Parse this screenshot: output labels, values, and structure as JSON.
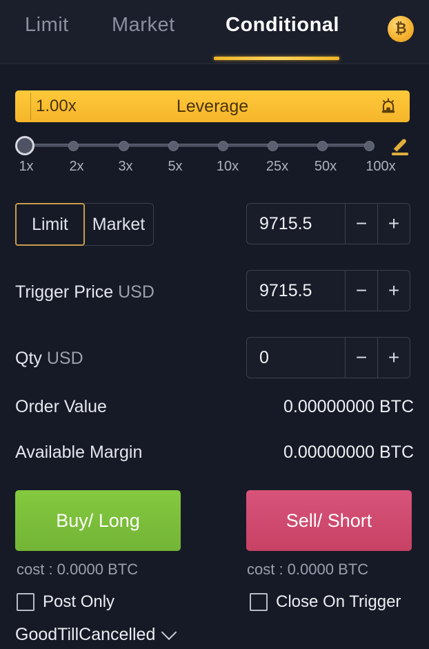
{
  "tabs": [
    {
      "label": "Limit",
      "selected": false
    },
    {
      "label": "Market",
      "selected": false
    },
    {
      "label": "Conditional",
      "selected": true
    }
  ],
  "header": {
    "currency_badge": "₿",
    "currency_icon": "bitcoin-icon"
  },
  "leverage": {
    "value": "1.00x",
    "label": "Leverage",
    "alarm_icon": "alarm-lamp-icon",
    "edit_icon": "pencil-edit-icon",
    "ticks": [
      "1x",
      "2x",
      "3x",
      "5x",
      "10x",
      "25x",
      "50x",
      "100x"
    ],
    "selected_tick_index": 0
  },
  "order_type": {
    "options": [
      {
        "label": "Limit",
        "selected": true
      },
      {
        "label": "Market",
        "selected": false
      }
    ]
  },
  "fields": [
    {
      "name": "price",
      "label": "",
      "unit": "",
      "value": "9715.5",
      "minus": "−",
      "plus": "+"
    },
    {
      "name": "trigger-price",
      "label": "Trigger Price",
      "unit": "USD",
      "value": "9715.5",
      "minus": "−",
      "plus": "+"
    },
    {
      "name": "qty",
      "label": "Qty",
      "unit": "USD",
      "value": "0",
      "minus": "−",
      "plus": "+"
    }
  ],
  "info": [
    {
      "label": "Order Value",
      "value": "0.00000000 BTC"
    },
    {
      "label": "Available Margin",
      "value": "0.00000000 BTC"
    }
  ],
  "actions": {
    "buy_label": "Buy/ Long",
    "sell_label": "Sell/ Short",
    "buy_cost": "cost : 0.0000 BTC",
    "sell_cost": "cost : 0.0000 BTC"
  },
  "checkboxes": [
    {
      "label": "Post Only",
      "checked": false
    },
    {
      "label": "Close On Trigger",
      "checked": false
    }
  ],
  "time_in_force": {
    "value": "GoodTillCancelled",
    "caret_icon": "chevron-down-icon"
  },
  "colors": {
    "background": "#161a26",
    "accent_gold": "#f0b429",
    "buy_green": "#7ac13f",
    "sell_pink": "#d14c6f"
  }
}
